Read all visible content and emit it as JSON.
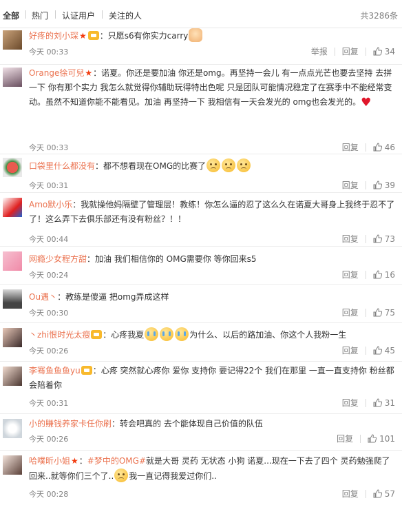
{
  "tabs": {
    "all": "全部",
    "hot": "热门",
    "verified": "认证用户",
    "following": "关注的人"
  },
  "total": "共3286条",
  "labels": {
    "report": "举报",
    "reply": "回复",
    "reply_alt": "回复"
  },
  "comments": [
    {
      "user": "好疼的刘小琛",
      "sep": "：",
      "text": "只愿s6有你实力carry",
      "time": "今天 00:33",
      "likes": "34"
    },
    {
      "user": "Orange徐可兒",
      "sep": "：",
      "text": "诺夏。你还是要加油 你还是omg。再坚持一会儿 有一点点光芒也要去坚持 去拼一下 你有那个实力 我怎么就觉得你辅助玩得特出色呢 只是团队可能情况稳定了在赛季中不能经常变动。虽然不知道你能不能看见。加油 再坚持一下 我相信有一天会发光的 omg也会发光的。",
      "time": "今天 00:33",
      "likes": "46"
    },
    {
      "user": "口袋里什么都没有",
      "sep": "：",
      "text": "都不想看现在OMG的比赛了",
      "time": "今天 00:31",
      "likes": "39"
    },
    {
      "user": "Amo默小乐",
      "sep": "：",
      "text": "我就操他妈隔壁了管理层！教练！你怎么逼的忍了这么久在诺夏大哥身上我终于忍不了了！这么弄下去俱乐部还有没有粉丝？！！",
      "time": "今天 00:44",
      "likes": "73"
    },
    {
      "user": "网瘾少女程方甜",
      "sep": "：",
      "text": "加油 我们相信你的 OMG需要你 等你回来s5",
      "time": "今天 00:24",
      "likes": "16"
    },
    {
      "user": "Ou遇丶",
      "sep": "：",
      "text": "教练是傻逼 把omg弄成这样",
      "time": "今天 00:30",
      "likes": "75"
    },
    {
      "user": "丶zhi恨时光太瘦",
      "sep": "：",
      "text_a": "心疼我夏",
      "text_b": "为什么、以后的路加油、你这个人我粉一生",
      "time": "今天 00:26",
      "likes": "45"
    },
    {
      "user": "李骞鱼鱼鱼yu",
      "sep": "：",
      "text": "心疼 突然就心疼你 爱你 支持你 要记得22个 我们在那里 一直一直支持你 粉丝都会陪着你",
      "time": "今天 00:31",
      "likes": "31"
    },
    {
      "user": "小的賺钱养家卡任你刷",
      "sep": "：",
      "text": "转会吧真的 去个能体现自己价值的队伍",
      "time": "今天 00:26",
      "likes": "101"
    },
    {
      "user": "哈噗昕小姐",
      "sep": "：",
      "text_a": "#梦中的OMG#",
      "text_b": "就是大哥 灵药 无状态 小狗 诺夏...现在一下去了四个 灵药勉强爬了回来..就等你们三个了..",
      "text_c": "我一直记得我爱过你们..",
      "time": "今天 00:28",
      "likes": "57"
    }
  ],
  "colors": {
    "username": "#eb7350",
    "topic": "#eb7350",
    "meta": "#808080"
  },
  "icons": {
    "vip": "red-star-icon",
    "member": "weibo-member-icon",
    "like": "thumbs-up-icon"
  }
}
